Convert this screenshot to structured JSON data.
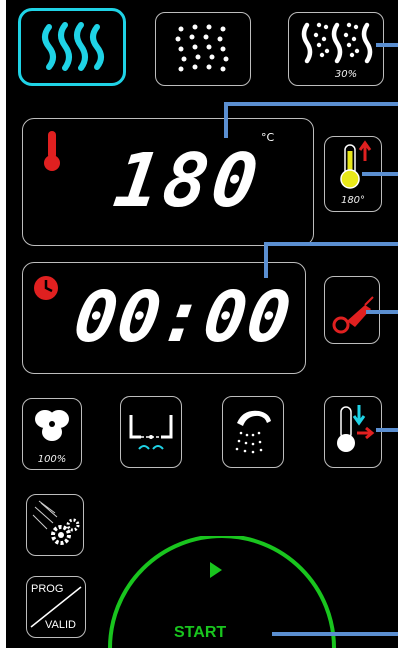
{
  "modes": {
    "convection": {
      "icon": "convection-heat-icon",
      "selected": true
    },
    "steam": {
      "icon": "steam-dots-icon"
    },
    "combi": {
      "icon": "combi-steam-icon",
      "label": "30%"
    }
  },
  "temperature": {
    "value": "180",
    "unit": "°C",
    "icon": "thermometer-icon",
    "probe": {
      "icon": "thermometer-up-icon",
      "label": "180°"
    }
  },
  "timer": {
    "value": "00:00",
    "icon": "clock-icon",
    "probe": {
      "icon": "core-probe-icon"
    }
  },
  "functions": {
    "fan": {
      "icon": "fan-icon",
      "label": "100%"
    },
    "drain": {
      "icon": "drain-valve-icon"
    },
    "shower": {
      "icon": "hand-shower-icon"
    },
    "cooldown": {
      "icon": "cool-down-thermometer-icon"
    }
  },
  "settings": {
    "icon": "settings-gears-icon"
  },
  "program": {
    "prog_label": "PROG",
    "valid_label": "VALID"
  },
  "start": {
    "label": "START",
    "icon": "play-icon"
  },
  "colors": {
    "panel": "#000000",
    "active": "#1fd3e6",
    "start": "#19c51e",
    "alert_red": "#e02020",
    "probe_yellow": "#e8e81a",
    "callout": "#5b8fd1"
  }
}
